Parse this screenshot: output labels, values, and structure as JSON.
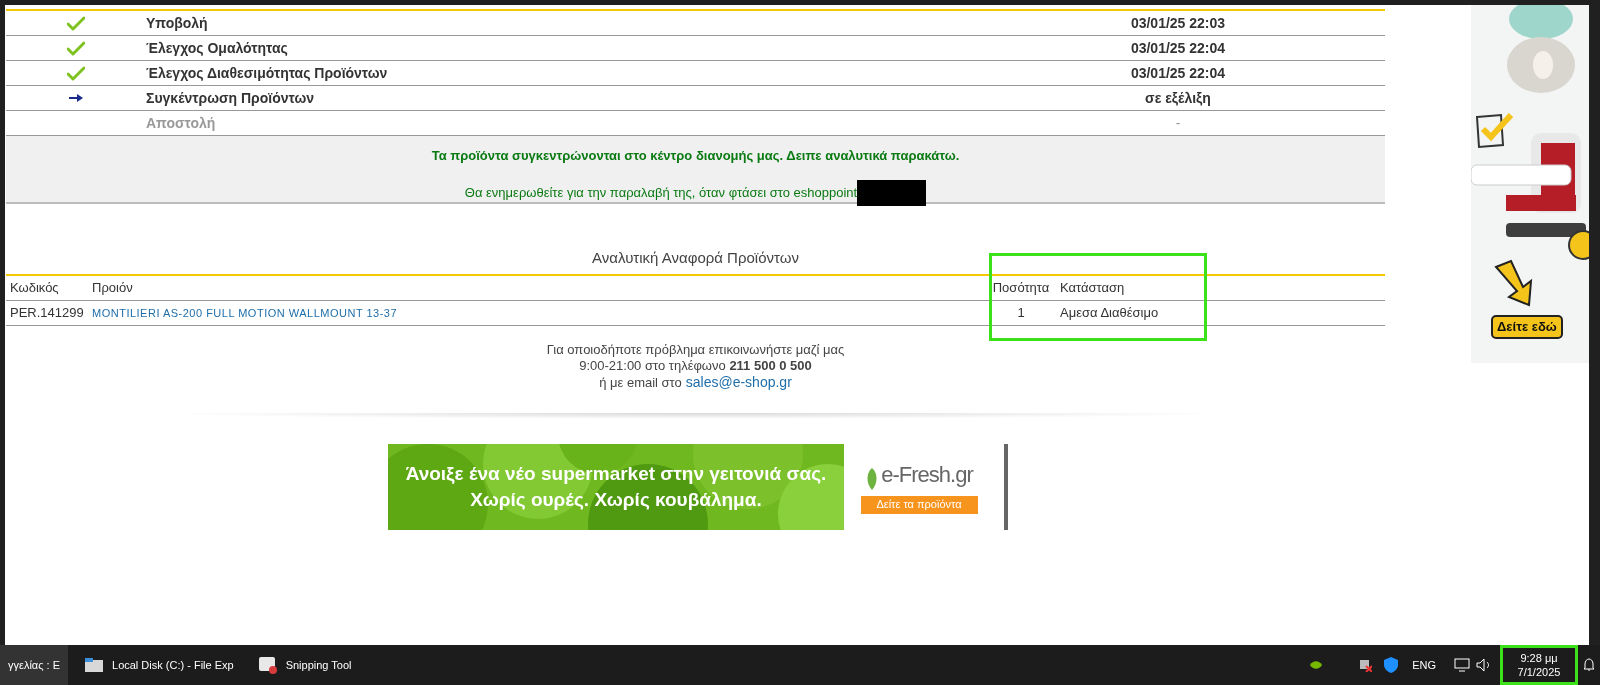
{
  "progress": {
    "steps": [
      {
        "kind": "done",
        "label": "Υποβολή",
        "time": "03/01/25 22:03"
      },
      {
        "kind": "done",
        "label": "Έλεγχος Ομαλότητας",
        "time": "03/01/25 22:04"
      },
      {
        "kind": "done",
        "label": "Έλεγχος Διαθεσιμότητας Προϊόντων",
        "time": "03/01/25 22:04"
      },
      {
        "kind": "current",
        "label": "Συγκέντρωση Προϊόντων",
        "time": "σε εξέλιξη"
      },
      {
        "kind": "pending",
        "label": "Αποστολή",
        "time": "-"
      }
    ]
  },
  "notice": {
    "headline": "Τα προϊόντα συγκεντρώνονται στο κέντρο διανομής μας. Δειπε αναλυτικά παρακάτω.",
    "message": "Θα ενημερωθείτε για την παραλαβή της, όταν φτάσει στο eshoppoint",
    "redacted": true
  },
  "products": {
    "title": "Αναλυτική Αναφορά Προϊόντων",
    "columns": [
      "Κωδικός",
      "Προιόν",
      "Ποσότητα",
      "Κατάσταση"
    ],
    "rows": [
      {
        "code": "PER.141299",
        "product": "MONTILIERI AS-200 FULL MOTION WALLMOUNT 13-37",
        "quantity": "1",
        "status": "Αμεσα Διαθέσιμο"
      }
    ]
  },
  "contact": {
    "line_1": "Για οποιοδήποτε πρόβλημα επικοινωνήστε μαζί μας",
    "line_2": "9:00-21:00 στο τηλέφωνο **211 500 0 500**",
    "line_3": "ή με email στο",
    "email": "sales@e-shop.gr"
  },
  "banner": {
    "headline_1": "Άνοιξε ένα νέο supermarket στην γειτονιά σας.",
    "headline_2": "Χωρίς ουρές. Χωρίς κουβάλημα.",
    "logo": "e-Fresh.gr",
    "button": "Δείτε τα προϊόντα"
  },
  "side_ad": {
    "button": "Δείτε εδώ"
  },
  "taskbar": {
    "items": [
      {
        "kind": "plain",
        "label": "γγελίας : E",
        "selected": true
      },
      {
        "kind": "folder",
        "label": "Local Disk (C:) - File Exp",
        "selected": false
      },
      {
        "kind": "snip",
        "label": "Snipping Tool",
        "selected": false
      }
    ],
    "language": "ENG",
    "time": "9:28 μμ",
    "date": "7/1/2025"
  }
}
